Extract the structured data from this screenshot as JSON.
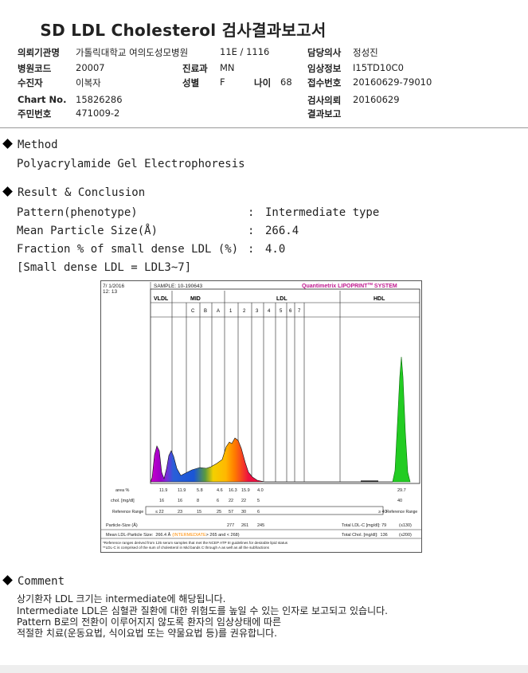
{
  "report": {
    "title": "SD LDL Cholesterol 검사결과보고서"
  },
  "header": {
    "institution_label": "의뢰기관명",
    "institution_value": "가톨릭대학교 여의도성모병원",
    "ward_value": "11E / 1116",
    "doctor_label": "담당의사",
    "doctor_value": "정성진",
    "hospital_code_label": "병원코드",
    "hospital_code_value": "20007",
    "dept_label": "진료과",
    "dept_value": "MN",
    "clinical_label": "임상정보",
    "clinical_value": "I15TD10C0",
    "patient_label": "수진자",
    "patient_value": "이복자",
    "sex_label": "성별",
    "sex_value": "F",
    "age_label": "나이",
    "age_value": "68",
    "receipt_label": "접수번호",
    "receipt_value": "20160629-79010",
    "chart_label": "Chart No.",
    "chart_value": "15826286",
    "request_date_label": "검사의뢰",
    "request_date_value": "20160629",
    "resident_label": "주민번호",
    "resident_value": "471009-2",
    "report_label": "결과보고",
    "report_value": ""
  },
  "method": {
    "heading": "Method",
    "text": "Polyacrylamide Gel Electrophoresis"
  },
  "result": {
    "heading": "Result & Conclusion",
    "pattern_label": "Pattern(phenotype)",
    "pattern_value": "Intermediate type",
    "size_label": "Mean Particle Size(Å)",
    "size_value": "266.4",
    "fraction_label": "Fraction % of small dense LDL (%)",
    "fraction_value": "4.0",
    "note": "[Small dense LDL = LDL3~7]",
    "colon": ":"
  },
  "lipoprint": {
    "date": "7/ 1/2016",
    "time": "12: 13",
    "sample": "SAMPLE:  10-190643",
    "brand": "Quantimetrix LIPOPRINT",
    "brand_tm": "TM",
    "brand_suffix": " SYSTEM",
    "group_vldl": "VLDL",
    "group_mid": "MID",
    "group_ldl": "LDL",
    "group_hdl": "HDL",
    "band_labels": [
      "C",
      "B",
      "A",
      "1",
      "2",
      "3",
      "4",
      "5",
      "6",
      "7"
    ],
    "row_area_label": "area %",
    "area_values": [
      "11.9",
      "11.9",
      "5.8",
      "4.6",
      "16.3",
      "15.9",
      "4.0",
      "29.7"
    ],
    "row_chol_label": "chol. [mg/dl]",
    "chol_values": [
      "16",
      "16",
      "8",
      "6",
      "22",
      "22",
      "5",
      "40"
    ],
    "ref_label": "Reference Range",
    "ref_values": [
      "≤ 22",
      "23",
      "15",
      "25",
      "57",
      "30",
      "6",
      "≥ 40"
    ],
    "ref_label_right": "Reference Range",
    "particle_size_label": "Particle-Size (Å)",
    "particle_size_values": [
      "277",
      "261",
      "245"
    ],
    "total_ldlc_label": "Total LDL-C [mg/dl]: 79",
    "total_ldlc_ref": "(≤130)",
    "mean_label": "Mean LDL-Particle Size:",
    "mean_value": "266.4 Å",
    "mean_type": "(INTERMEDIATE",
    "mean_ranges": "> 265 and < 268)",
    "total_chol_label": "Total Chol. [mg/dl]:",
    "total_chol_value": "136",
    "total_chol_ref": "(≤200)",
    "footnote1": "*Reference ranges derived from 125 serum samples that met the NCEP ATP III guidelines for desirable lipid status",
    "footnote2": "**LDL-C is comprised of the sum of cholesterol in Mid bands C through A as well as all the subfractions"
  },
  "comment": {
    "heading": "Comment",
    "lines": [
      "상기환자 LDL 크기는 intermediate에 해당됩니다.",
      "Intermediate LDL은 심혈관 질환에 대한 위험도를 높일 수 있는 인자로 보고되고 있습니다.",
      "Pattern B로의 전환이 이루어지지 않도록 환자의 임상상태에 따른",
      "적절한 치료(운동요법, 식이요법 또는 약물요법 등)를 권유합니다."
    ]
  },
  "colors": {
    "vldl": "#9a00c8",
    "mid": "#1a55d6",
    "ldl1": "#f4d000",
    "ldl2": "#e65c00",
    "hdl": "#22cc22",
    "brand": "#c0198f",
    "intermediate": "#ff8c00"
  }
}
